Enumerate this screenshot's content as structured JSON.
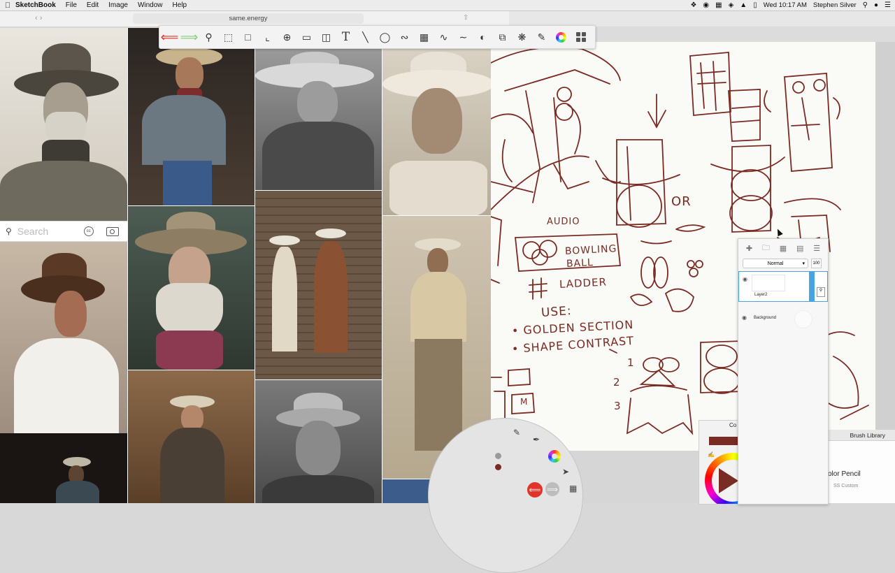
{
  "menubar": {
    "app_name": "SketchBook",
    "menus": [
      "File",
      "Edit",
      "Image",
      "Window",
      "Help"
    ],
    "clock": "Wed 10:17 AM",
    "user": "Stephen Silver"
  },
  "browser": {
    "url": "same.energy"
  },
  "search": {
    "placeholder": "Search",
    "cc_label": "cc"
  },
  "canvas_text": {
    "audio": "AUDIO",
    "bowling": "BOWLING",
    "ball": "BALL",
    "ladder": "LADDER",
    "use": "USE:",
    "golden": "• GOLDEN SECTION",
    "shape": "• SHAPE CONTRAST",
    "or": "OR",
    "n1": "1",
    "n2": "2",
    "n3": "3",
    "m": "M"
  },
  "layers": {
    "blend_mode": "Normal",
    "opacity": "100",
    "items": [
      {
        "name": "Layer2",
        "selected": true
      },
      {
        "name": "Background",
        "selected": false
      }
    ]
  },
  "color_editor": {
    "title": "Co",
    "current_color": "#7a2b23"
  },
  "brush_library": {
    "title": "Brush Library",
    "brush_name": "olor Pencil",
    "brush_set": "SS Custom"
  },
  "colors": {
    "ink": "#7a2b23",
    "undo": "#e0342b",
    "redo": "#7fd070",
    "selection": "#4aa3df"
  }
}
